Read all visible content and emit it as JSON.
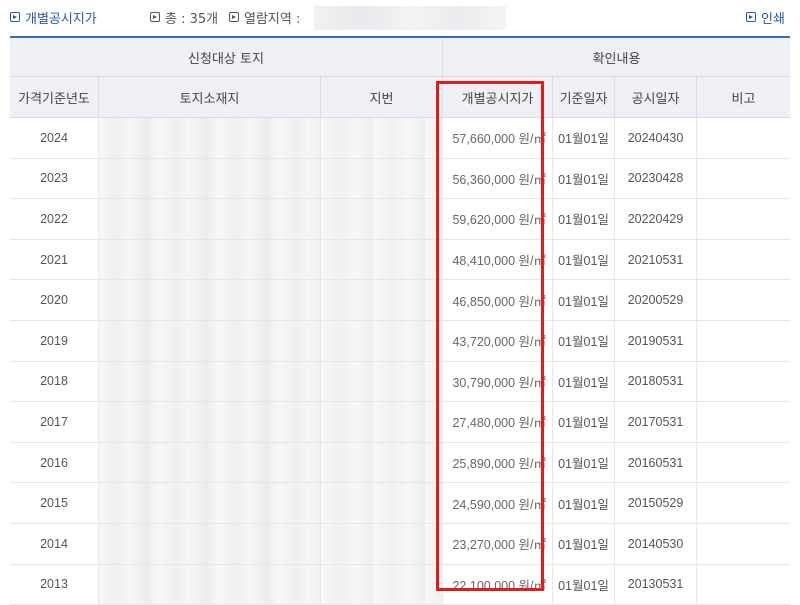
{
  "topbar": {
    "title": "개별공시지가",
    "count_text": "총 : 35개",
    "region_label": "열람지역 :",
    "print_label": "인쇄"
  },
  "table": {
    "group_headers": [
      "신청대상 토지",
      "확인내용"
    ],
    "columns": [
      "가격기준년도",
      "토지소재지",
      "지번",
      "개별공시지가",
      "기준일자",
      "공시일자",
      "비고"
    ],
    "rows": [
      {
        "year": "2024",
        "price": "57,660,000 원/㎡",
        "base_date": "01월01일",
        "notice_date": "20240430"
      },
      {
        "year": "2023",
        "price": "56,360,000 원/㎡",
        "base_date": "01월01일",
        "notice_date": "20230428"
      },
      {
        "year": "2022",
        "price": "59,620,000 원/㎡",
        "base_date": "01월01일",
        "notice_date": "20220429"
      },
      {
        "year": "2021",
        "price": "48,410,000 원/㎡",
        "base_date": "01월01일",
        "notice_date": "20210531"
      },
      {
        "year": "2020",
        "price": "46,850,000 원/㎡",
        "base_date": "01월01일",
        "notice_date": "20200529"
      },
      {
        "year": "2019",
        "price": "43,720,000 원/㎡",
        "base_date": "01월01일",
        "notice_date": "20190531"
      },
      {
        "year": "2018",
        "price": "30,790,000 원/㎡",
        "base_date": "01월01일",
        "notice_date": "20180531"
      },
      {
        "year": "2017",
        "price": "27,480,000 원/㎡",
        "base_date": "01월01일",
        "notice_date": "20170531"
      },
      {
        "year": "2016",
        "price": "25,890,000 원/㎡",
        "base_date": "01월01일",
        "notice_date": "20160531"
      },
      {
        "year": "2015",
        "price": "24,590,000 원/㎡",
        "base_date": "01월01일",
        "notice_date": "20150529"
      },
      {
        "year": "2014",
        "price": "23,270,000 원/㎡",
        "base_date": "01월01일",
        "notice_date": "20140530"
      },
      {
        "year": "2013",
        "price": "22,100,000 원/㎡",
        "base_date": "01월01일",
        "notice_date": "20130531"
      }
    ]
  },
  "colors": {
    "accent": "#2a57a8",
    "header_bg": "#eef0f5",
    "highlight": "#e21b1b"
  }
}
